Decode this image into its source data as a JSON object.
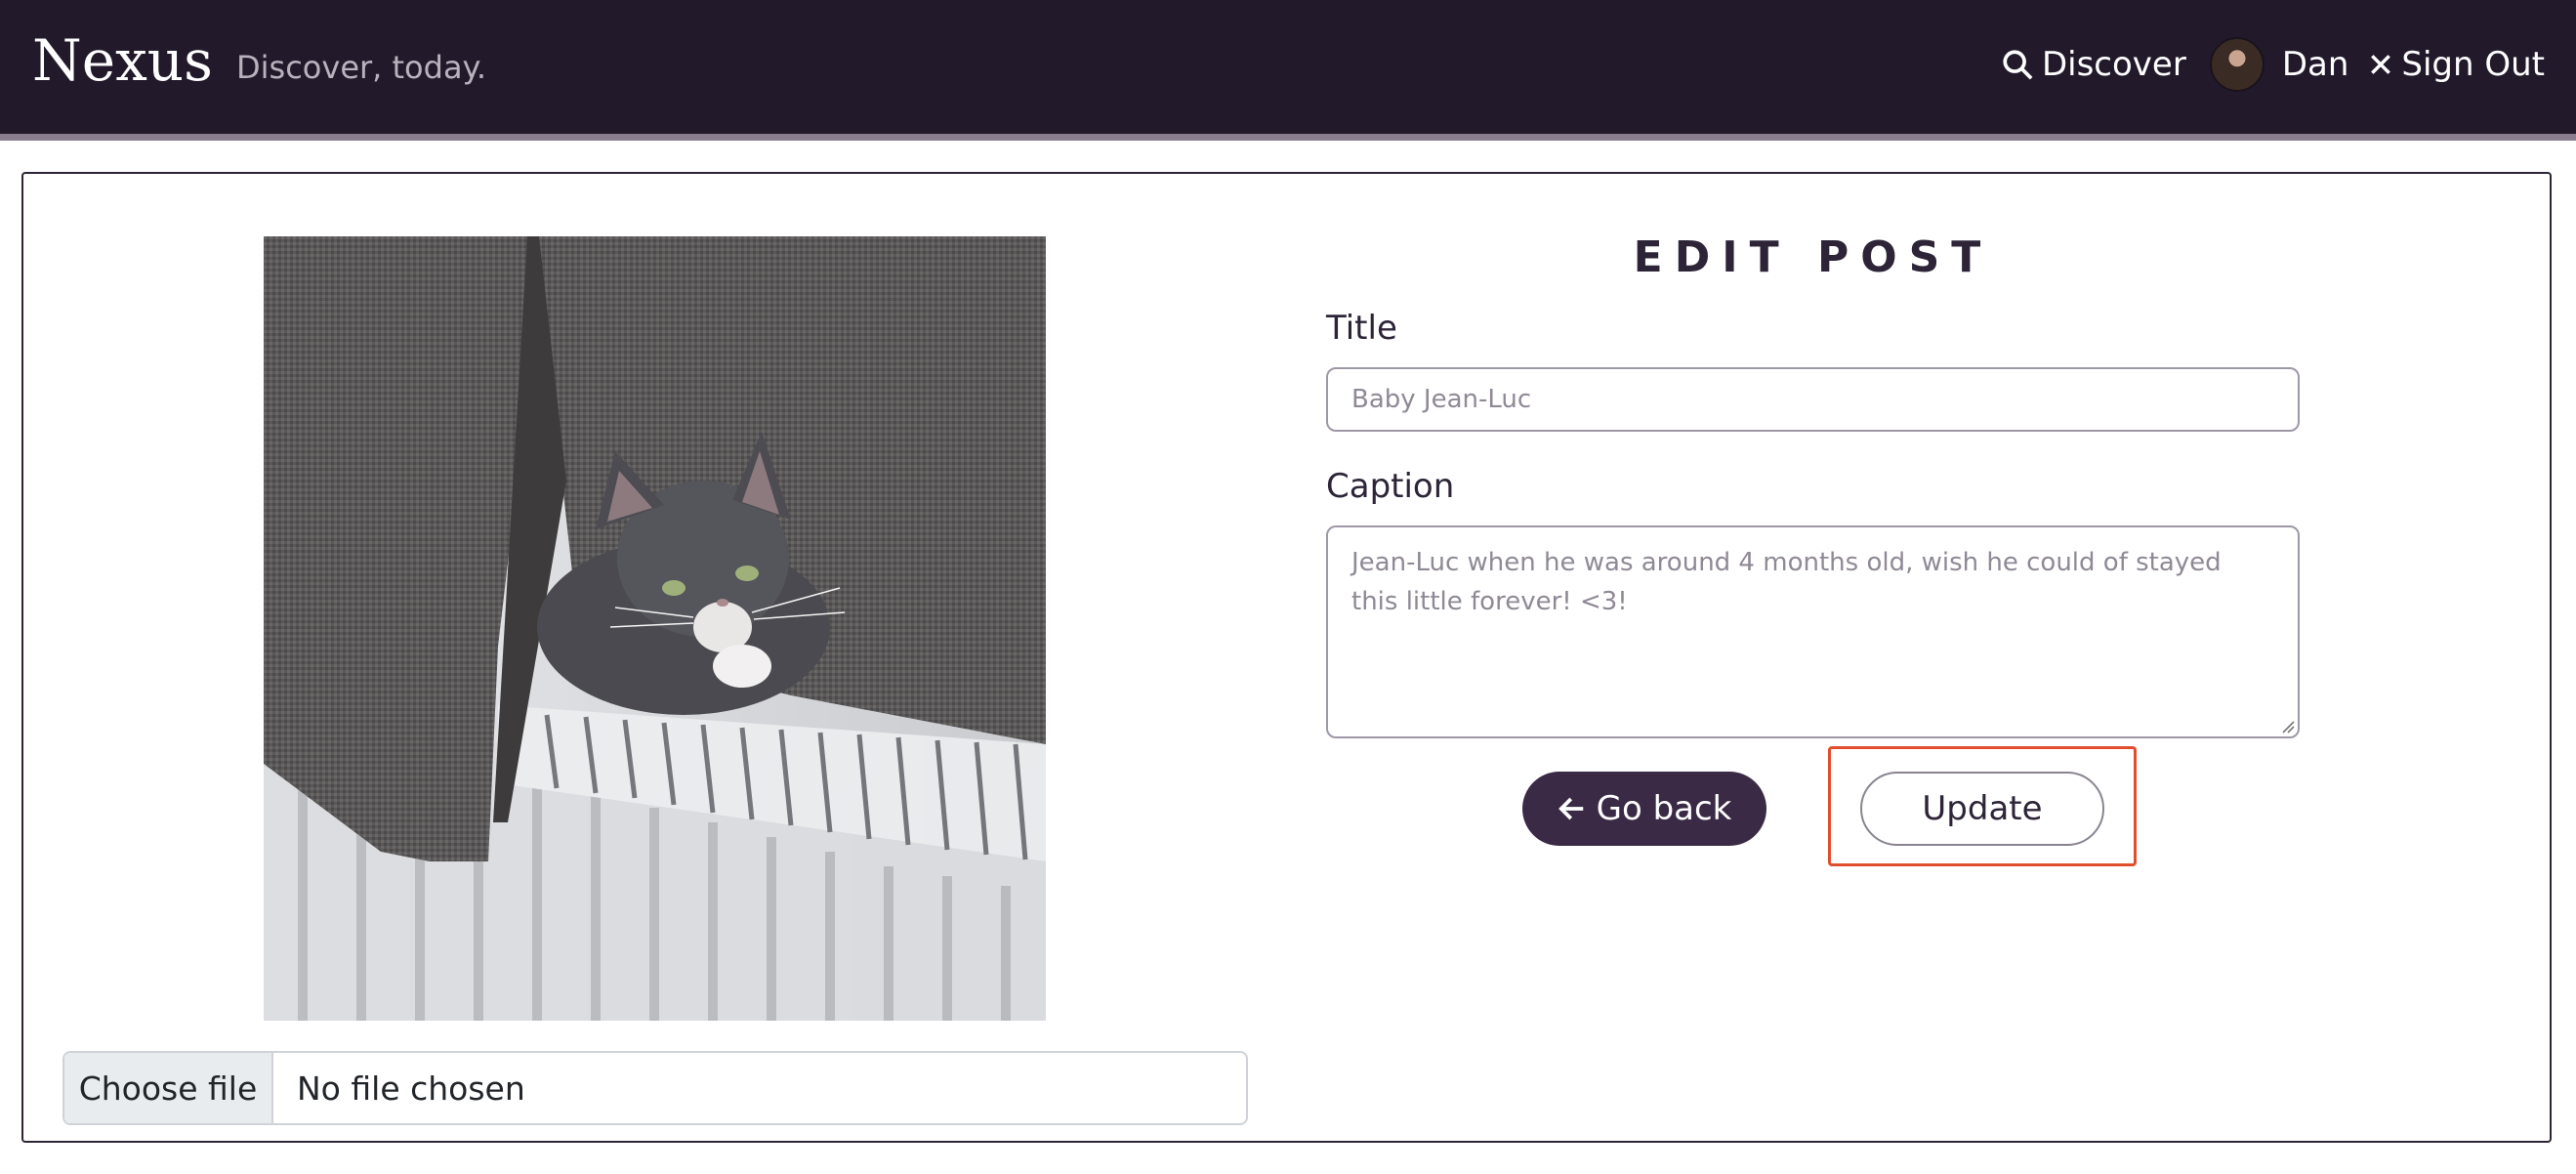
{
  "navbar": {
    "brand": "Nexus",
    "tagline": "Discover, today.",
    "discover_label": "Discover",
    "user_name": "Dan",
    "signout_label": "Sign Out"
  },
  "left": {
    "image_alt": "Grey and white kitten lying on a radiator beside a curtain",
    "file_button": "Choose file",
    "file_status": "No file chosen"
  },
  "form": {
    "heading": "EDIT POST",
    "title_label": "Title",
    "title_value": "Baby Jean-Luc",
    "caption_label": "Caption",
    "caption_value": "Jean-Luc when he was around 4 months old, wish he could of stayed this little forever! <3!",
    "back_label": "Go back",
    "update_label": "Update"
  },
  "colors": {
    "navbar_bg": "#221a2b",
    "primary_button": "#3a2a45",
    "highlight": "#e04e2e"
  }
}
